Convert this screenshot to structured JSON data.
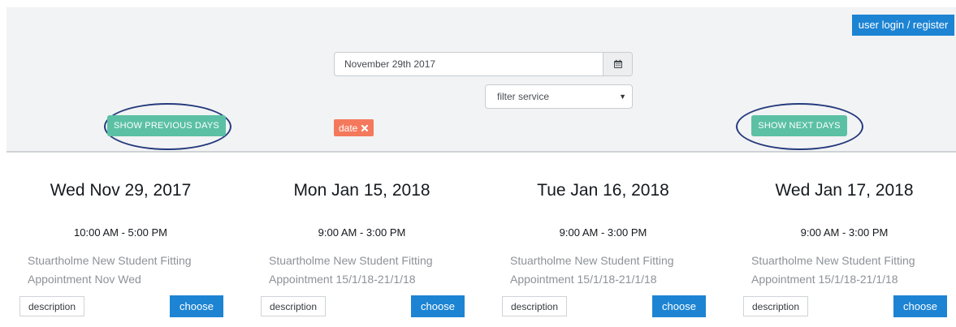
{
  "header": {
    "login_register_label": "user login / register",
    "accent_color": "#1d84d3"
  },
  "filters": {
    "date_value": "November 29th 2017",
    "calendar_icon": "calendar-icon",
    "service_select_value": "filter service",
    "service_options": [
      "filter service"
    ],
    "show_previous_days_label": "SHOW PREVIOUS DAYS",
    "show_next_days_label": "SHOW NEXT DAYS",
    "nav_color": "#5bc0a4",
    "active_tag_label": "date",
    "tag_color": "#f4795c",
    "tag_remove_icon": "close-icon"
  },
  "annotations": {
    "highlight_color": "#243a7d"
  },
  "slots": [
    {
      "date": "Wed Nov 29, 2017",
      "time": "10:00 AM - 5:00 PM",
      "service_line_1": "Stuartholme New Student Fitting",
      "service_line_2": "Appointment Nov Wed",
      "description_label": "description",
      "choose_label": "choose"
    },
    {
      "date": "Mon Jan 15, 2018",
      "time": "9:00 AM - 3:00 PM",
      "service_line_1": "Stuartholme New Student Fitting",
      "service_line_2": "Appointment 15/1/18-21/1/18",
      "description_label": "description",
      "choose_label": "choose"
    },
    {
      "date": "Tue Jan 16, 2018",
      "time": "9:00 AM - 3:00 PM",
      "service_line_1": "Stuartholme New Student Fitting",
      "service_line_2": "Appointment 15/1/18-21/1/18",
      "description_label": "description",
      "choose_label": "choose"
    },
    {
      "date": "Wed Jan 17, 2018",
      "time": "9:00 AM - 3:00 PM",
      "service_line_1": "Stuartholme New Student Fitting",
      "service_line_2": "Appointment 15/1/18-21/1/18",
      "description_label": "description",
      "choose_label": "choose"
    }
  ]
}
